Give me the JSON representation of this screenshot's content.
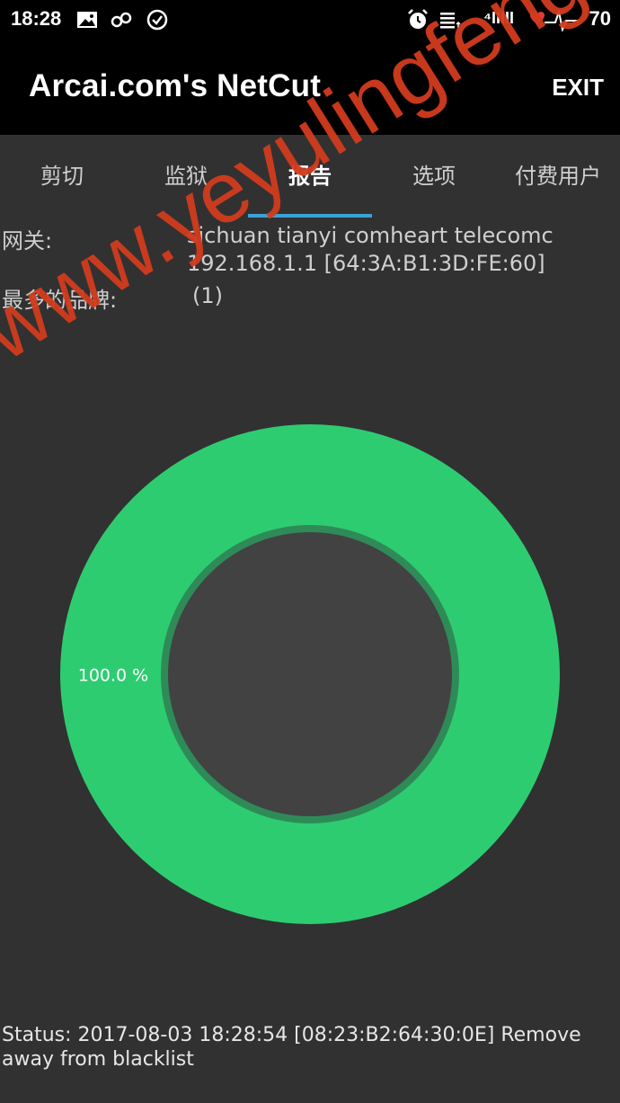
{
  "status_bar": {
    "time": "18:28",
    "signal_text": "⁴IIIII",
    "battery": "70"
  },
  "app": {
    "title": "Arcai.com's NetCut",
    "exit_label": "EXIT"
  },
  "tabs": [
    {
      "label": "剪切",
      "active": false
    },
    {
      "label": "监狱",
      "active": false
    },
    {
      "label": "报告",
      "active": true
    },
    {
      "label": "选项",
      "active": false
    },
    {
      "label": "付费用户",
      "active": false
    }
  ],
  "info": {
    "gateway_label": "网关:",
    "gateway_name": "sichuan tianyi comheart telecomc",
    "gateway_ip": "192.168.1.1 [64:3A:B1:3D:FE:60]",
    "brand_label": "最多的品牌:",
    "brand_value": "(1)"
  },
  "watermark": "www.yeyulingfeng.com",
  "chart_data": {
    "type": "pie",
    "donut": true,
    "slices": [
      {
        "label": "100.0 %",
        "value": 100.0,
        "color": "#2ecc71"
      }
    ],
    "center_color": "#424242",
    "ring_border_color": "#2e8b57"
  },
  "status_text": "Status: 2017-08-03 18:28:54 [08:23:B2:64:30:0E] Remove away from blacklist",
  "colors": {
    "background": "#313131",
    "bar": "#000000",
    "accent": "#3aa3d8",
    "watermark": "#d23c1e"
  }
}
